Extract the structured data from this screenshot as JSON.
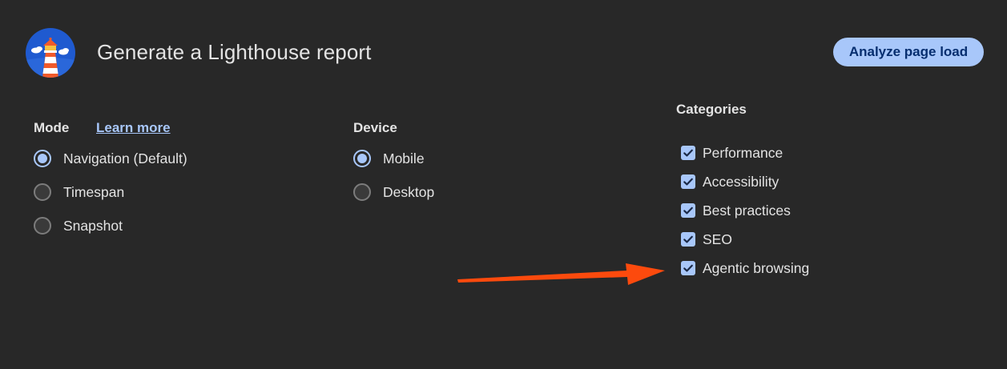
{
  "header": {
    "title": "Generate a Lighthouse report",
    "analyze_label": "Analyze page load",
    "logo_icon": "lighthouse-logo-icon"
  },
  "mode": {
    "label": "Mode",
    "learn_more": "Learn more",
    "options": [
      {
        "label": "Navigation (Default)",
        "checked": true
      },
      {
        "label": "Timespan",
        "checked": false
      },
      {
        "label": "Snapshot",
        "checked": false
      }
    ]
  },
  "device": {
    "label": "Device",
    "options": [
      {
        "label": "Mobile",
        "checked": true
      },
      {
        "label": "Desktop",
        "checked": false
      }
    ]
  },
  "categories": {
    "label": "Categories",
    "items": [
      {
        "label": "Performance",
        "checked": true
      },
      {
        "label": "Accessibility",
        "checked": true
      },
      {
        "label": "Best practices",
        "checked": true
      },
      {
        "label": "SEO",
        "checked": true
      },
      {
        "label": "Agentic browsing",
        "checked": true
      }
    ]
  },
  "annotation": {
    "arrow_color": "#fc4a0d",
    "arrow_icon": "arrow-right-icon"
  },
  "colors": {
    "background": "#282828",
    "accent": "#a8c7fa",
    "button_text": "#062e6f"
  }
}
